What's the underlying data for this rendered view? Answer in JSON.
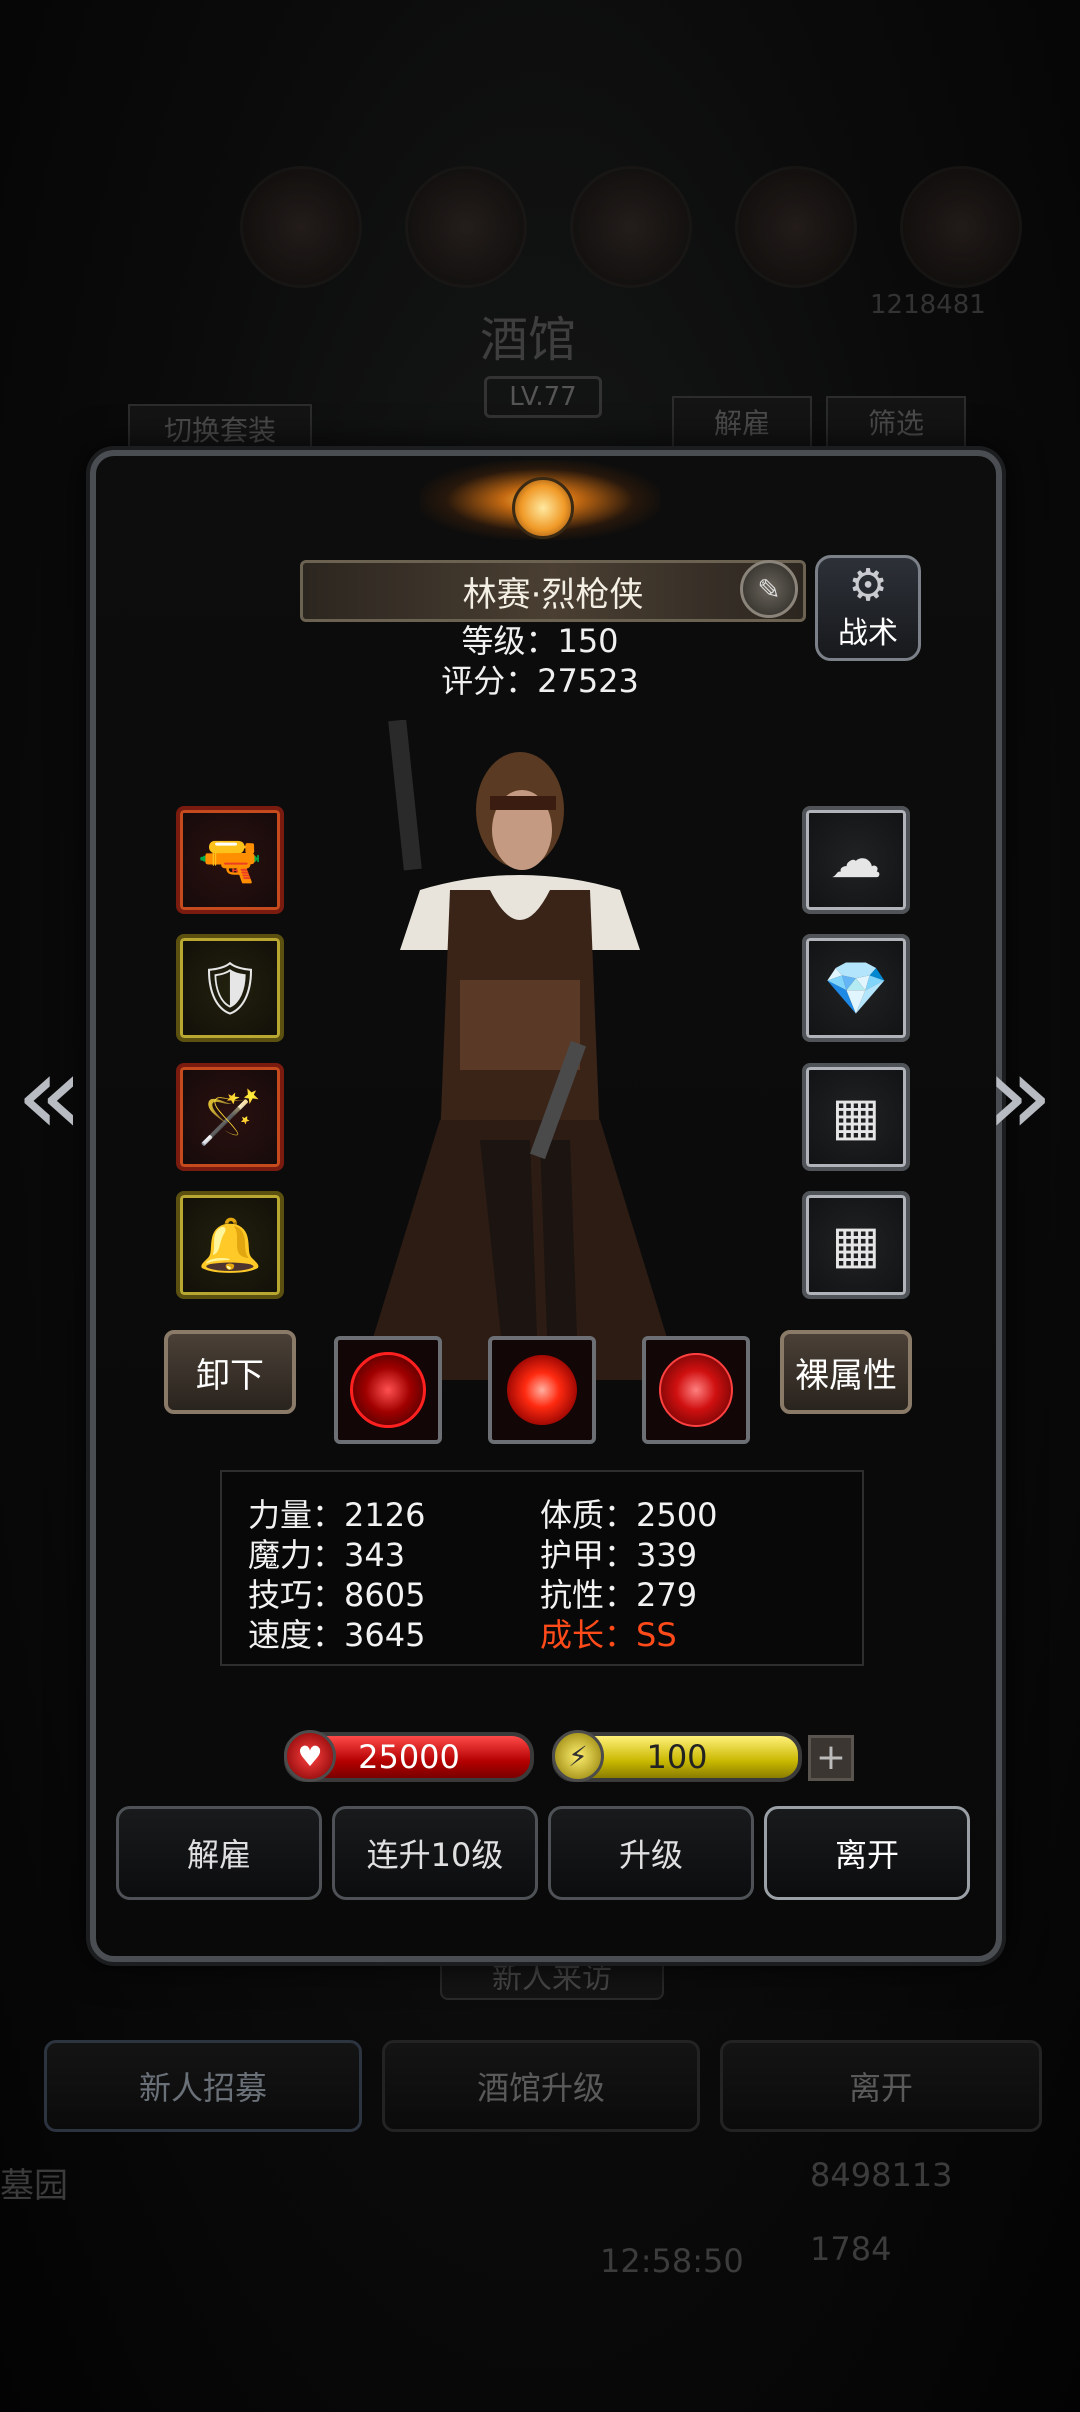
{
  "background": {
    "tavern_title": "酒馆",
    "tavern_level": "LV.77",
    "switch_outfit_label": "切换套装",
    "dismiss_label": "解雇",
    "filter_label": "筛选",
    "hidden_number": "1218481",
    "new_visitor_label": "新人来访",
    "bottom_tabs": [
      "新人招募",
      "酒馆升级",
      "离开"
    ],
    "gold_amount": "8498113",
    "gem_amount": "1784",
    "clock": "12:58:50",
    "side_text_left": "墓园"
  },
  "hero": {
    "name": "林赛·烈枪侠",
    "level_label": "等级：150",
    "score_label": "评分：27523",
    "tactics_label": "战术"
  },
  "equipment": {
    "left": [
      {
        "icon": "flintlock-pistol-icon",
        "glyph": "🔫",
        "rarity": "red"
      },
      {
        "icon": "armor-icon",
        "glyph": "🛡",
        "rarity": "gold"
      },
      {
        "icon": "wand-icon",
        "glyph": "🪄",
        "rarity": "red"
      },
      {
        "icon": "bell-icon",
        "glyph": "🔔",
        "rarity": "gold"
      }
    ],
    "right": [
      {
        "icon": "cloud-amulet-icon",
        "glyph": "☁",
        "rarity": "gray"
      },
      {
        "icon": "green-crystal-icon",
        "glyph": "💎",
        "rarity": "gray"
      },
      {
        "icon": "chainmail-icon",
        "glyph": "▦",
        "rarity": "gray"
      },
      {
        "icon": "chainmail-icon",
        "glyph": "▦",
        "rarity": "gray"
      }
    ]
  },
  "buttons": {
    "unequip": "卸下",
    "base_attributes": "裸属性"
  },
  "stats": {
    "strength": "力量：2126",
    "constitution": "体质：2500",
    "magic": "魔力：343",
    "armor": "护甲：339",
    "skill": "技巧：8605",
    "resistance": "抗性：279",
    "speed": "速度：3645",
    "growth": "成长：SS"
  },
  "resources": {
    "hp": "25000",
    "energy": "100"
  },
  "actions": [
    "解雇",
    "连升10级",
    "升级",
    "离开"
  ],
  "colors": {
    "growth_text": "#ff4a1a",
    "hp_bar": "#d01010",
    "energy_bar": "#e0d000"
  }
}
